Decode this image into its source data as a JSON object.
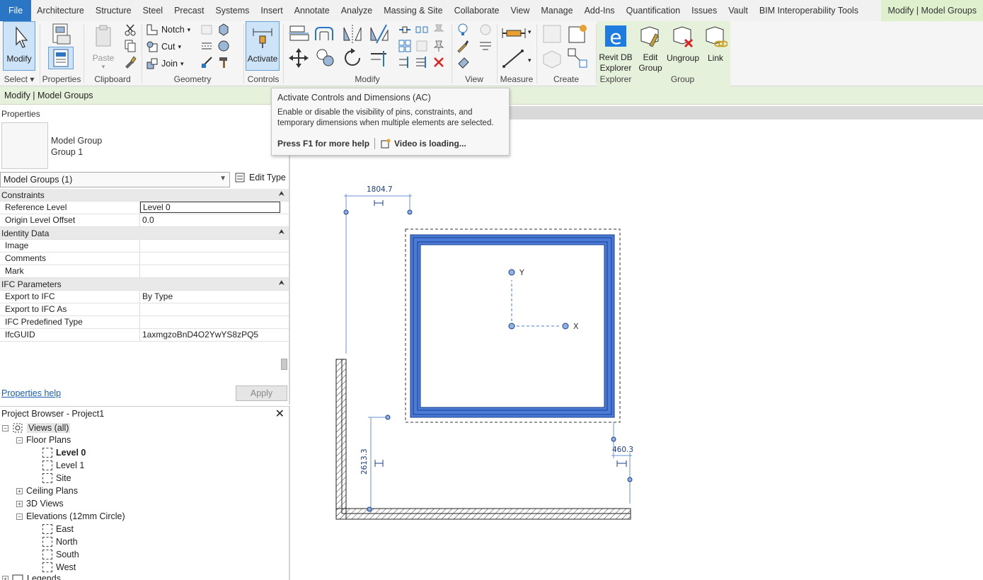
{
  "tabs": [
    "File",
    "Architecture",
    "Structure",
    "Steel",
    "Precast",
    "Systems",
    "Insert",
    "Annotate",
    "Analyze",
    "Massing & Site",
    "Collaborate",
    "View",
    "Manage",
    "Add-Ins",
    "Quantification",
    "Issues",
    "Vault",
    "BIM Interoperability Tools",
    "Modify | Model Groups"
  ],
  "ribbon": {
    "modify_label": "Modify",
    "paste_label": "Paste",
    "notch_label": "Notch",
    "cut_label": "Cut",
    "join_label": "Join",
    "activate_label": "Activate",
    "revit_db_explorer_label": "Revit DB Explorer",
    "edit_group_label": "Edit Group",
    "ungroup_label": "Ungroup",
    "link_label": "Link",
    "panels": {
      "select": "Select",
      "properties": "Properties",
      "clipboard": "Clipboard",
      "geometry": "Geometry",
      "controls": "Controls",
      "modify": "Modify",
      "view": "View",
      "measure": "Measure",
      "create": "Create",
      "explorer": "Explorer",
      "group": "Group"
    }
  },
  "options_bar": {
    "text": "Modify | Model Groups"
  },
  "tooltip": {
    "title": "Activate Controls and Dimensions (AC)",
    "description": "Enable or disable the visibility of pins, constraints, and temporary dimensions when multiple elements are selected.",
    "help": "Press F1 for more help",
    "video": "Video is loading..."
  },
  "properties": {
    "title": "Properties",
    "type_line1": "Model Group",
    "type_line2": "Group 1",
    "selector": "Model Groups (1)",
    "edit_type": "Edit Type",
    "categories": [
      {
        "name": "Constraints",
        "rows": [
          {
            "k": "Reference Level",
            "v": "Level 0"
          },
          {
            "k": "Origin Level Offset",
            "v": "0.0"
          }
        ]
      },
      {
        "name": "Identity Data",
        "rows": [
          {
            "k": "Image",
            "v": ""
          },
          {
            "k": "Comments",
            "v": ""
          },
          {
            "k": "Mark",
            "v": ""
          }
        ]
      },
      {
        "name": "IFC Parameters",
        "rows": [
          {
            "k": "Export to IFC",
            "v": "By Type"
          },
          {
            "k": "Export to IFC As",
            "v": ""
          },
          {
            "k": "IFC Predefined Type",
            "v": ""
          },
          {
            "k": "IfcGUID",
            "v": "1axmgzoBnD4O2YwYS8zPQ5"
          }
        ]
      }
    ],
    "help_link": "Properties help",
    "apply": "Apply"
  },
  "browser": {
    "title": "Project Browser - Project1",
    "views_all": "Views (all)",
    "floor_plans": "Floor Plans",
    "level0": "Level 0",
    "level1": "Level 1",
    "site": "Site",
    "ceiling_plans": "Ceiling Plans",
    "views_3d": "3D Views",
    "elevations": "Elevations (12mm Circle)",
    "east": "East",
    "north": "North",
    "south": "South",
    "west": "West",
    "legends": "Legends"
  },
  "drawing": {
    "dim_top": "1804.7",
    "dim_left": "2613.3",
    "dim_right": "460.3",
    "axis_y": "Y",
    "axis_x": "X"
  },
  "colors": {
    "accent": "#2a75c4",
    "context": "#e6f1dc",
    "selection": "#4a7bd8"
  }
}
